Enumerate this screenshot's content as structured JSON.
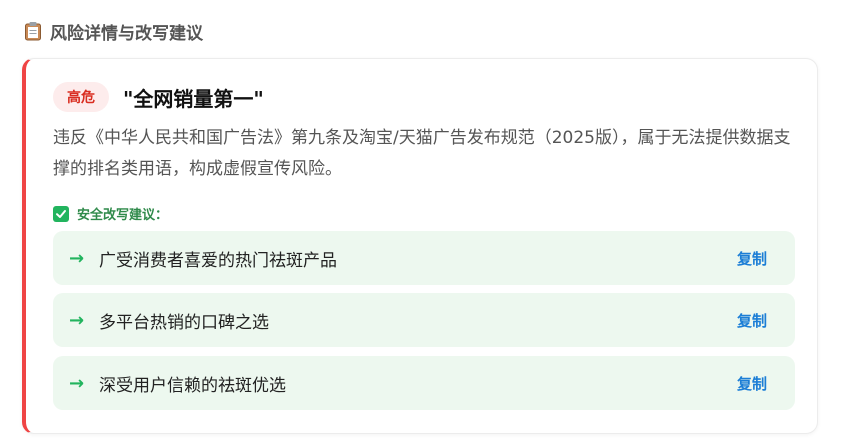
{
  "section": {
    "title": "风险详情与改写建议",
    "icon": "clipboard-icon"
  },
  "card": {
    "accent_color": "#ef4444",
    "badge": "高危",
    "phrase": "\"全网销量第一\"",
    "description": "违反《中华人民共和国广告法》第九条及淘宝/天猫广告发布规范（2025版），属于无法提供数据支撑的排名类用语，构成虚假宣传风险。",
    "suggest_label": "安全改写建议：",
    "suggestions": [
      {
        "arrow": "→",
        "text": "广受消费者喜爱的热门祛斑产品",
        "copy_label": "复制"
      },
      {
        "arrow": "→",
        "text": "多平台热销的口碑之选",
        "copy_label": "复制"
      },
      {
        "arrow": "→",
        "text": "深受用户信赖的祛斑优选",
        "copy_label": "复制"
      }
    ]
  }
}
